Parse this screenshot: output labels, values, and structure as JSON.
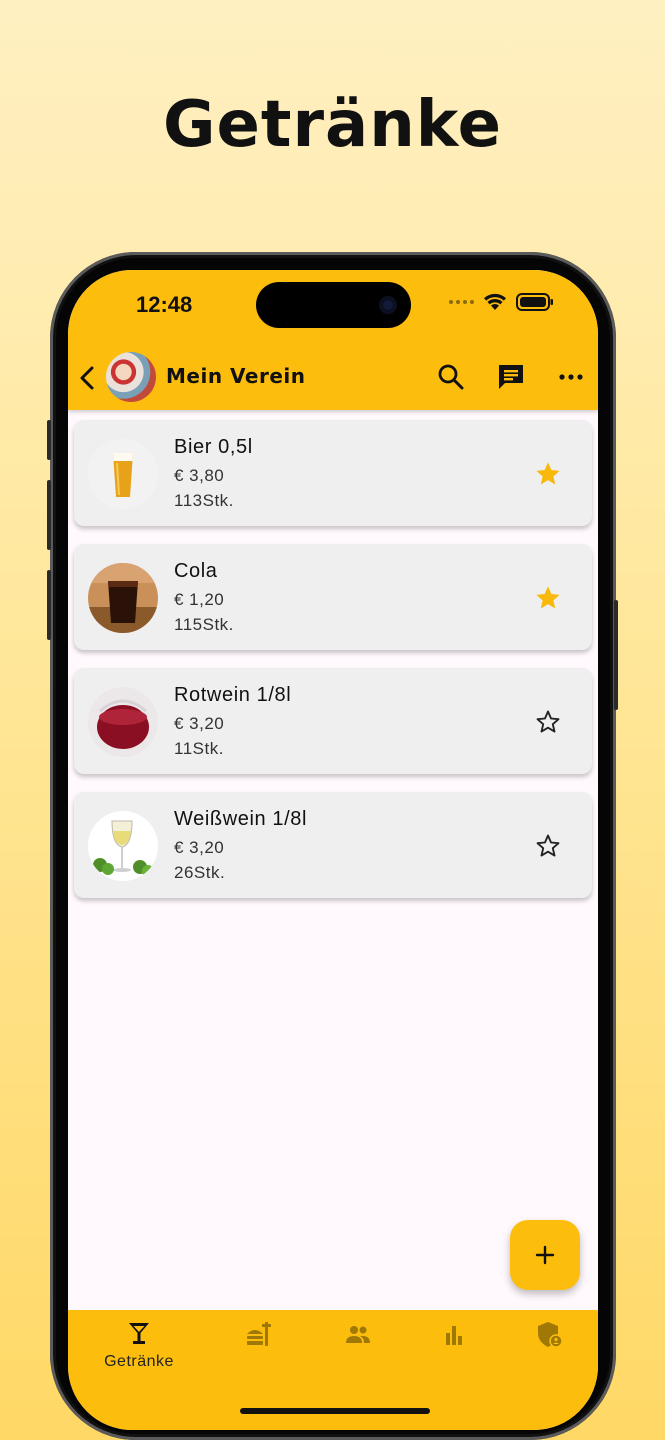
{
  "hero": {
    "title": "Getränke"
  },
  "status_bar": {
    "time": "12:48"
  },
  "app_bar": {
    "club_name": "Mein Verein",
    "icons": [
      "back-icon",
      "search-icon",
      "chat-icon",
      "more-icon"
    ]
  },
  "items": [
    {
      "name": "Bier 0,5l",
      "price": "€ 3,80",
      "stock": "113Stk.",
      "favorite": true,
      "image": "beer"
    },
    {
      "name": "Cola",
      "price": "€ 1,20",
      "stock": "115Stk.",
      "favorite": true,
      "image": "cola"
    },
    {
      "name": "Rotwein 1/8l",
      "price": "€ 3,20",
      "stock": "11Stk.",
      "favorite": false,
      "image": "red-wine"
    },
    {
      "name": "Weißwein 1/8l",
      "price": "€ 3,20",
      "stock": "26Stk.",
      "favorite": false,
      "image": "white-wine"
    }
  ],
  "bottom_nav": {
    "items": [
      {
        "icon": "cocktail-glass-icon",
        "label": "Getränke",
        "active": true
      },
      {
        "icon": "food-icon",
        "label": "",
        "active": false
      },
      {
        "icon": "people-icon",
        "label": "",
        "active": false
      },
      {
        "icon": "bar-chart-icon",
        "label": "",
        "active": false
      },
      {
        "icon": "admin-shield-icon",
        "label": "",
        "active": false
      }
    ]
  },
  "colors": {
    "accent": "#fdbd0c",
    "star_active": "#f9b90a",
    "card": "#efefef",
    "background_top": "#fff0c2",
    "background_bottom": "#ffd866"
  }
}
